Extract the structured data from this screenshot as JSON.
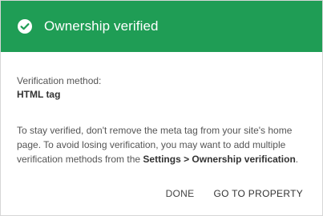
{
  "dialog": {
    "title": "Ownership verified",
    "header_color": "#1f9d55",
    "icon": "check-circle-icon",
    "method_label": "Verification method:",
    "method_value": "HTML tag",
    "info_text_part1": "To stay verified, don't remove the meta tag from your site's home page. To avoid losing verification, you may want to add multiple verification methods from the ",
    "info_text_link": "Settings > Ownership verification",
    "info_text_part2": ".",
    "buttons": {
      "done": "DONE",
      "go_to_property": "GO TO PROPERTY"
    }
  }
}
